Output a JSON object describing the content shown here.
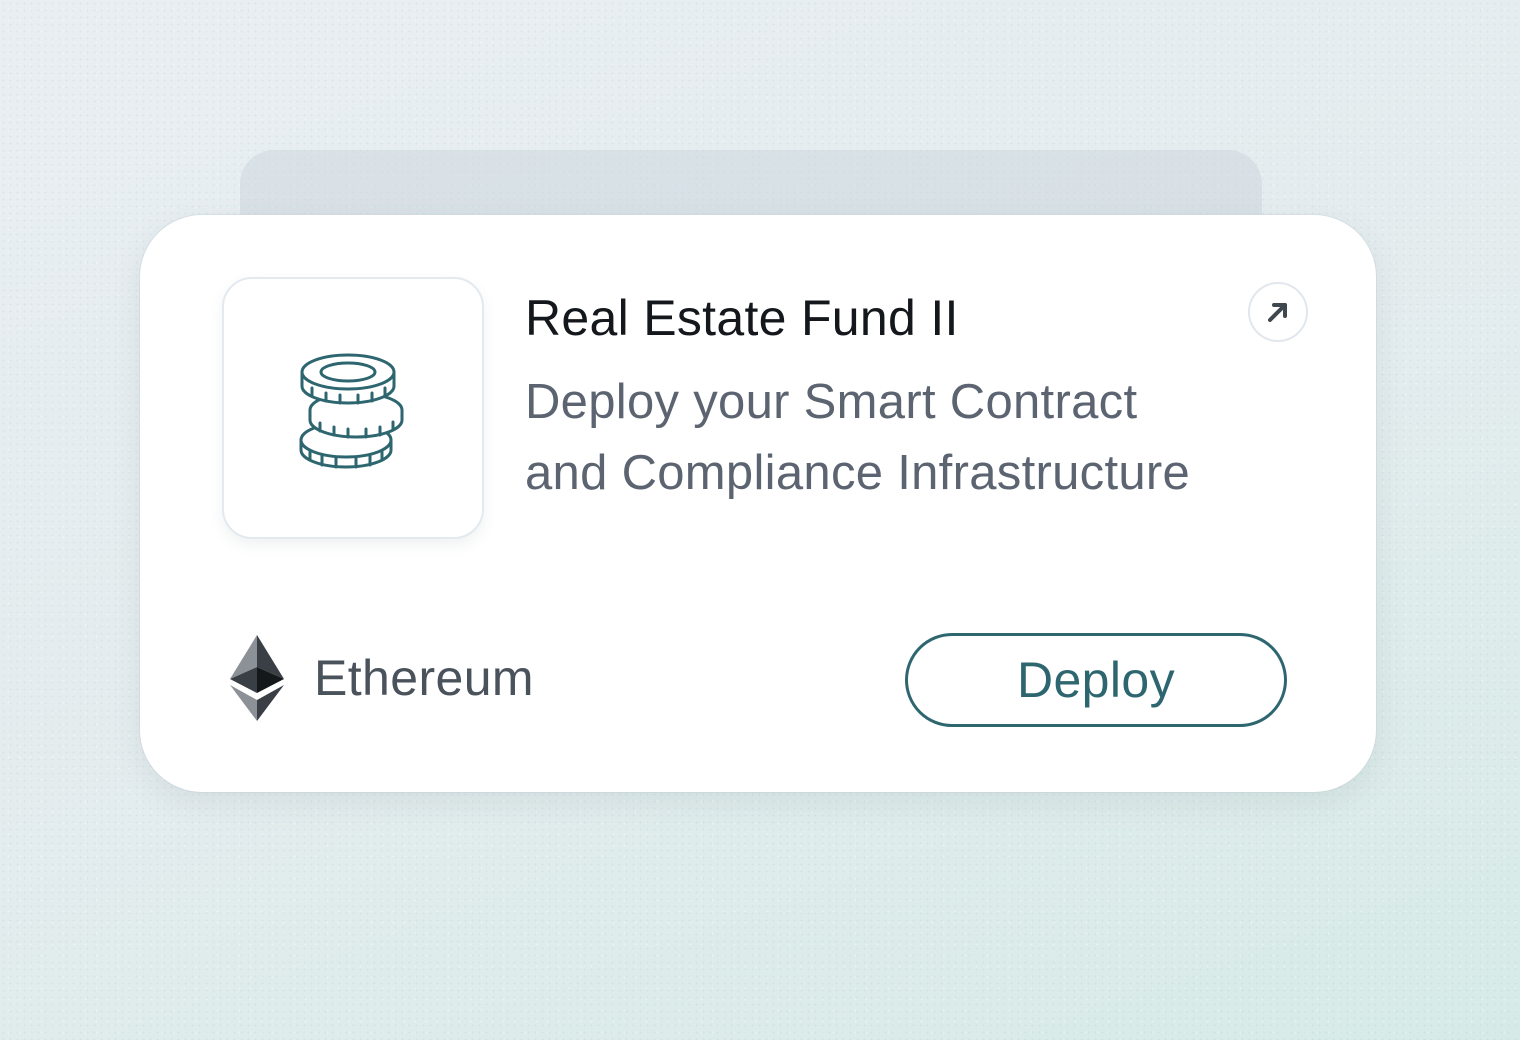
{
  "card": {
    "title": "Real Estate Fund II",
    "description_lines": [
      "Deploy your Smart Contract",
      "and Compliance Infrastructure"
    ],
    "icon": "coin-stack-icon",
    "open_icon": "arrow-up-right-icon",
    "network": {
      "label": "Ethereum",
      "icon": "ethereum-icon"
    },
    "deploy_label": "Deploy"
  },
  "colors": {
    "accent": "#2e6670",
    "title": "#14181c",
    "body_text": "#5b6470",
    "card_bg": "#ffffff"
  }
}
